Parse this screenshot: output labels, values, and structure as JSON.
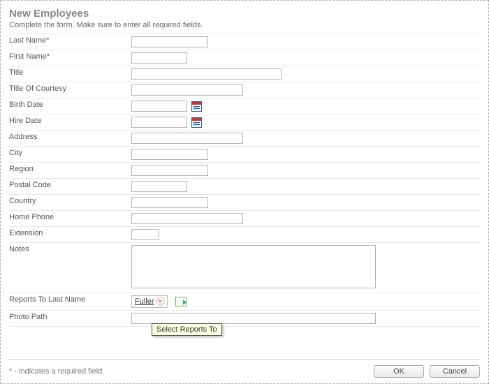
{
  "header": {
    "title": "New Employees",
    "instruction": "Complete the form. Make sure to enter all required fields."
  },
  "labels": {
    "last_name": "Last Name",
    "first_name": "First Name",
    "title": "Title",
    "title_of_courtesy": "Title Of Courtesy",
    "birth_date": "Birth Date",
    "hire_date": "Hire Date",
    "address": "Address",
    "city": "City",
    "region": "Region",
    "postal_code": "Postal Code",
    "country": "Country",
    "home_phone": "Home Phone",
    "extension": "Extension",
    "notes": "Notes",
    "reports_to": "Reports To Last Name",
    "photo_path": "Photo Path",
    "required_mark": "*"
  },
  "values": {
    "last_name": "",
    "first_name": "",
    "title": "",
    "title_of_courtesy": "",
    "birth_date": "",
    "hire_date": "",
    "address": "",
    "city": "",
    "region": "",
    "postal_code": "",
    "country": "",
    "home_phone": "",
    "extension": "",
    "notes": "",
    "reports_to": "Fuller",
    "photo_path": ""
  },
  "tooltip": {
    "reports_to": "Select Reports To"
  },
  "footer": {
    "footnote": "* - indicates a required field",
    "ok": "OK",
    "cancel": "Cancel"
  }
}
